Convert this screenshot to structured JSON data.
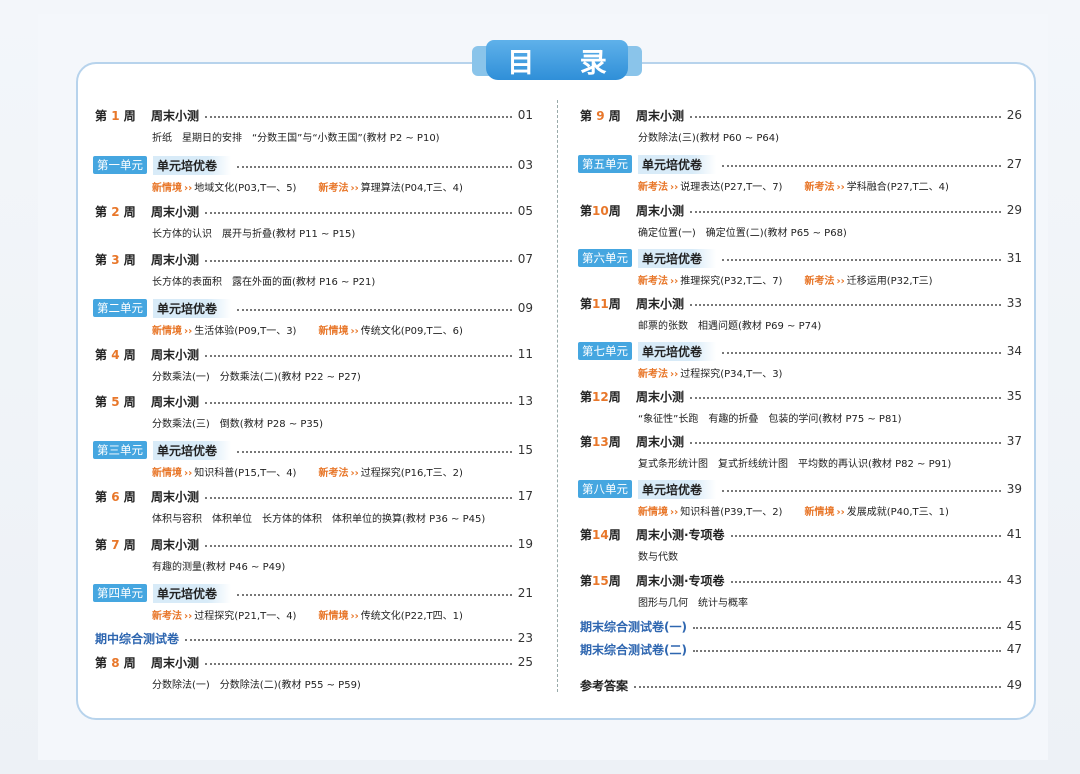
{
  "title": "目 录",
  "left": [
    {
      "type": "week",
      "num": "1",
      "label_prefix": "第",
      "label_suffix": "周",
      "title": "周末小测",
      "page": "01",
      "sub": [
        {
          "text": "折纸　星期日的安排　“分数王国”与“小数王国”(教材 P2 ~ P10)"
        }
      ]
    },
    {
      "type": "unit",
      "badge": "第一单元",
      "title": "单元培优卷",
      "page": "03",
      "sub": [
        {
          "tag": "新情境",
          "text": "地域文化(P03,T一、5)"
        },
        {
          "tag": "新考法",
          "text": "算理算法(P04,T三、4)"
        }
      ]
    },
    {
      "type": "week",
      "num": "2",
      "label_prefix": "第",
      "label_suffix": "周",
      "title": "周末小测",
      "page": "05",
      "sub": [
        {
          "text": "长方体的认识　展开与折叠(教材 P11 ~ P15)"
        }
      ]
    },
    {
      "type": "week",
      "num": "3",
      "label_prefix": "第",
      "label_suffix": "周",
      "title": "周末小测",
      "page": "07",
      "sub": [
        {
          "text": "长方体的表面积　露在外面的面(教材 P16 ~ P21)"
        }
      ]
    },
    {
      "type": "unit",
      "badge": "第二单元",
      "title": "单元培优卷",
      "page": "09",
      "sub": [
        {
          "tag": "新情境",
          "text": "生活体验(P09,T一、3)"
        },
        {
          "tag": "新情境",
          "text": "传统文化(P09,T二、6)"
        }
      ]
    },
    {
      "type": "week",
      "num": "4",
      "label_prefix": "第",
      "label_suffix": "周",
      "title": "周末小测",
      "page": "11",
      "sub": [
        {
          "text": "分数乘法(一)　分数乘法(二)(教材 P22 ~ P27)"
        }
      ]
    },
    {
      "type": "week",
      "num": "5",
      "label_prefix": "第",
      "label_suffix": "周",
      "title": "周末小测",
      "page": "13",
      "sub": [
        {
          "text": "分数乘法(三)　倒数(教材 P28 ~ P35)"
        }
      ]
    },
    {
      "type": "unit",
      "badge": "第三单元",
      "title": "单元培优卷",
      "page": "15",
      "sub": [
        {
          "tag": "新情境",
          "text": "知识科普(P15,T一、4)"
        },
        {
          "tag": "新考法",
          "text": "过程探究(P16,T三、2)"
        }
      ]
    },
    {
      "type": "week",
      "num": "6",
      "label_prefix": "第",
      "label_suffix": "周",
      "title": "周末小测",
      "page": "17",
      "sub": [
        {
          "text": "体积与容积　体积单位　长方体的体积　体积单位的换算(教材 P36 ~ P45)"
        }
      ]
    },
    {
      "type": "week",
      "num": "7",
      "label_prefix": "第",
      "label_suffix": "周",
      "title": "周末小测",
      "page": "19",
      "sub": [
        {
          "text": "有趣的测量(教材 P46 ~ P49)"
        }
      ]
    },
    {
      "type": "unit",
      "badge": "第四单元",
      "title": "单元培优卷",
      "page": "21",
      "sub": [
        {
          "tag": "新考法",
          "text": "过程探究(P21,T一、4)"
        },
        {
          "tag": "新情境",
          "text": "传统文化(P22,T四、1)"
        }
      ]
    },
    {
      "type": "special",
      "title": "期中综合测试卷",
      "page": "23",
      "sub": []
    },
    {
      "type": "week",
      "num": "8",
      "label_prefix": "第",
      "label_suffix": "周",
      "title": "周末小测",
      "page": "25",
      "sub": [
        {
          "text": "分数除法(一)　分数除法(二)(教材 P55 ~ P59)"
        }
      ]
    }
  ],
  "right": [
    {
      "type": "week",
      "num": "9",
      "label_prefix": "第",
      "label_suffix": "周",
      "title": "周末小测",
      "page": "26",
      "sub": [
        {
          "text": "分数除法(三)(教材 P60 ~ P64)"
        }
      ]
    },
    {
      "type": "unit",
      "badge": "第五单元",
      "title": "单元培优卷",
      "page": "27",
      "sub": [
        {
          "tag": "新考法",
          "text": "说理表达(P27,T一、7)"
        },
        {
          "tag": "新考法",
          "text": "学科融合(P27,T二、4)"
        }
      ]
    },
    {
      "type": "week",
      "num": "10",
      "label_prefix": "第",
      "label_suffix": "周",
      "title": "周末小测",
      "page": "29",
      "sub": [
        {
          "text": "确定位置(一)　确定位置(二)(教材 P65 ~ P68)"
        }
      ]
    },
    {
      "type": "unit",
      "badge": "第六单元",
      "title": "单元培优卷",
      "page": "31",
      "sub": [
        {
          "tag": "新考法",
          "text": "推理探究(P32,T二、7)"
        },
        {
          "tag": "新考法",
          "text": "迁移运用(P32,T三)"
        }
      ]
    },
    {
      "type": "week",
      "num": "11",
      "label_prefix": "第",
      "label_suffix": "周",
      "title": "周末小测",
      "page": "33",
      "sub": [
        {
          "text": "邮票的张数　相遇问题(教材 P69 ~ P74)"
        }
      ]
    },
    {
      "type": "unit",
      "badge": "第七单元",
      "title": "单元培优卷",
      "page": "34",
      "sub": [
        {
          "tag": "新考法",
          "text": "过程探究(P34,T一、3)"
        }
      ]
    },
    {
      "type": "week",
      "num": "12",
      "label_prefix": "第",
      "label_suffix": "周",
      "title": "周末小测",
      "page": "35",
      "sub": [
        {
          "text": "“象征性”长跑　有趣的折叠　包装的学问(教材 P75 ~ P81)"
        }
      ]
    },
    {
      "type": "week",
      "num": "13",
      "label_prefix": "第",
      "label_suffix": "周",
      "title": "周末小测",
      "page": "37",
      "sub": [
        {
          "text": "复式条形统计图　复式折线统计图　平均数的再认识(教材 P82 ~ P91)"
        }
      ]
    },
    {
      "type": "unit",
      "badge": "第八单元",
      "title": "单元培优卷",
      "page": "39",
      "sub": [
        {
          "tag": "新情境",
          "text": "知识科普(P39,T一、2)"
        },
        {
          "tag": "新情境",
          "text": "发展成就(P40,T三、1)"
        }
      ]
    },
    {
      "type": "week",
      "num": "14",
      "label_prefix": "第",
      "label_suffix": "周",
      "title": "周末小测·专项卷",
      "page": "41",
      "sub": [
        {
          "text": "数与代数"
        }
      ]
    },
    {
      "type": "week",
      "num": "15",
      "label_prefix": "第",
      "label_suffix": "周",
      "title": "周末小测·专项卷",
      "page": "43",
      "sub": [
        {
          "text": "图形与几何　统计与概率"
        }
      ]
    },
    {
      "type": "special",
      "title": "期末综合测试卷(一)",
      "page": "45",
      "sub": []
    },
    {
      "type": "special",
      "title": "期末综合测试卷(二)",
      "page": "47",
      "sub": []
    },
    {
      "type": "answers",
      "title": "参考答案",
      "page": "49",
      "sub": []
    }
  ],
  "arrow_glyph": "››",
  "colors": {
    "accent": "#e8772a",
    "badge": "#45a6e0",
    "special": "#2e66b0",
    "border": "#b7d3ec"
  }
}
